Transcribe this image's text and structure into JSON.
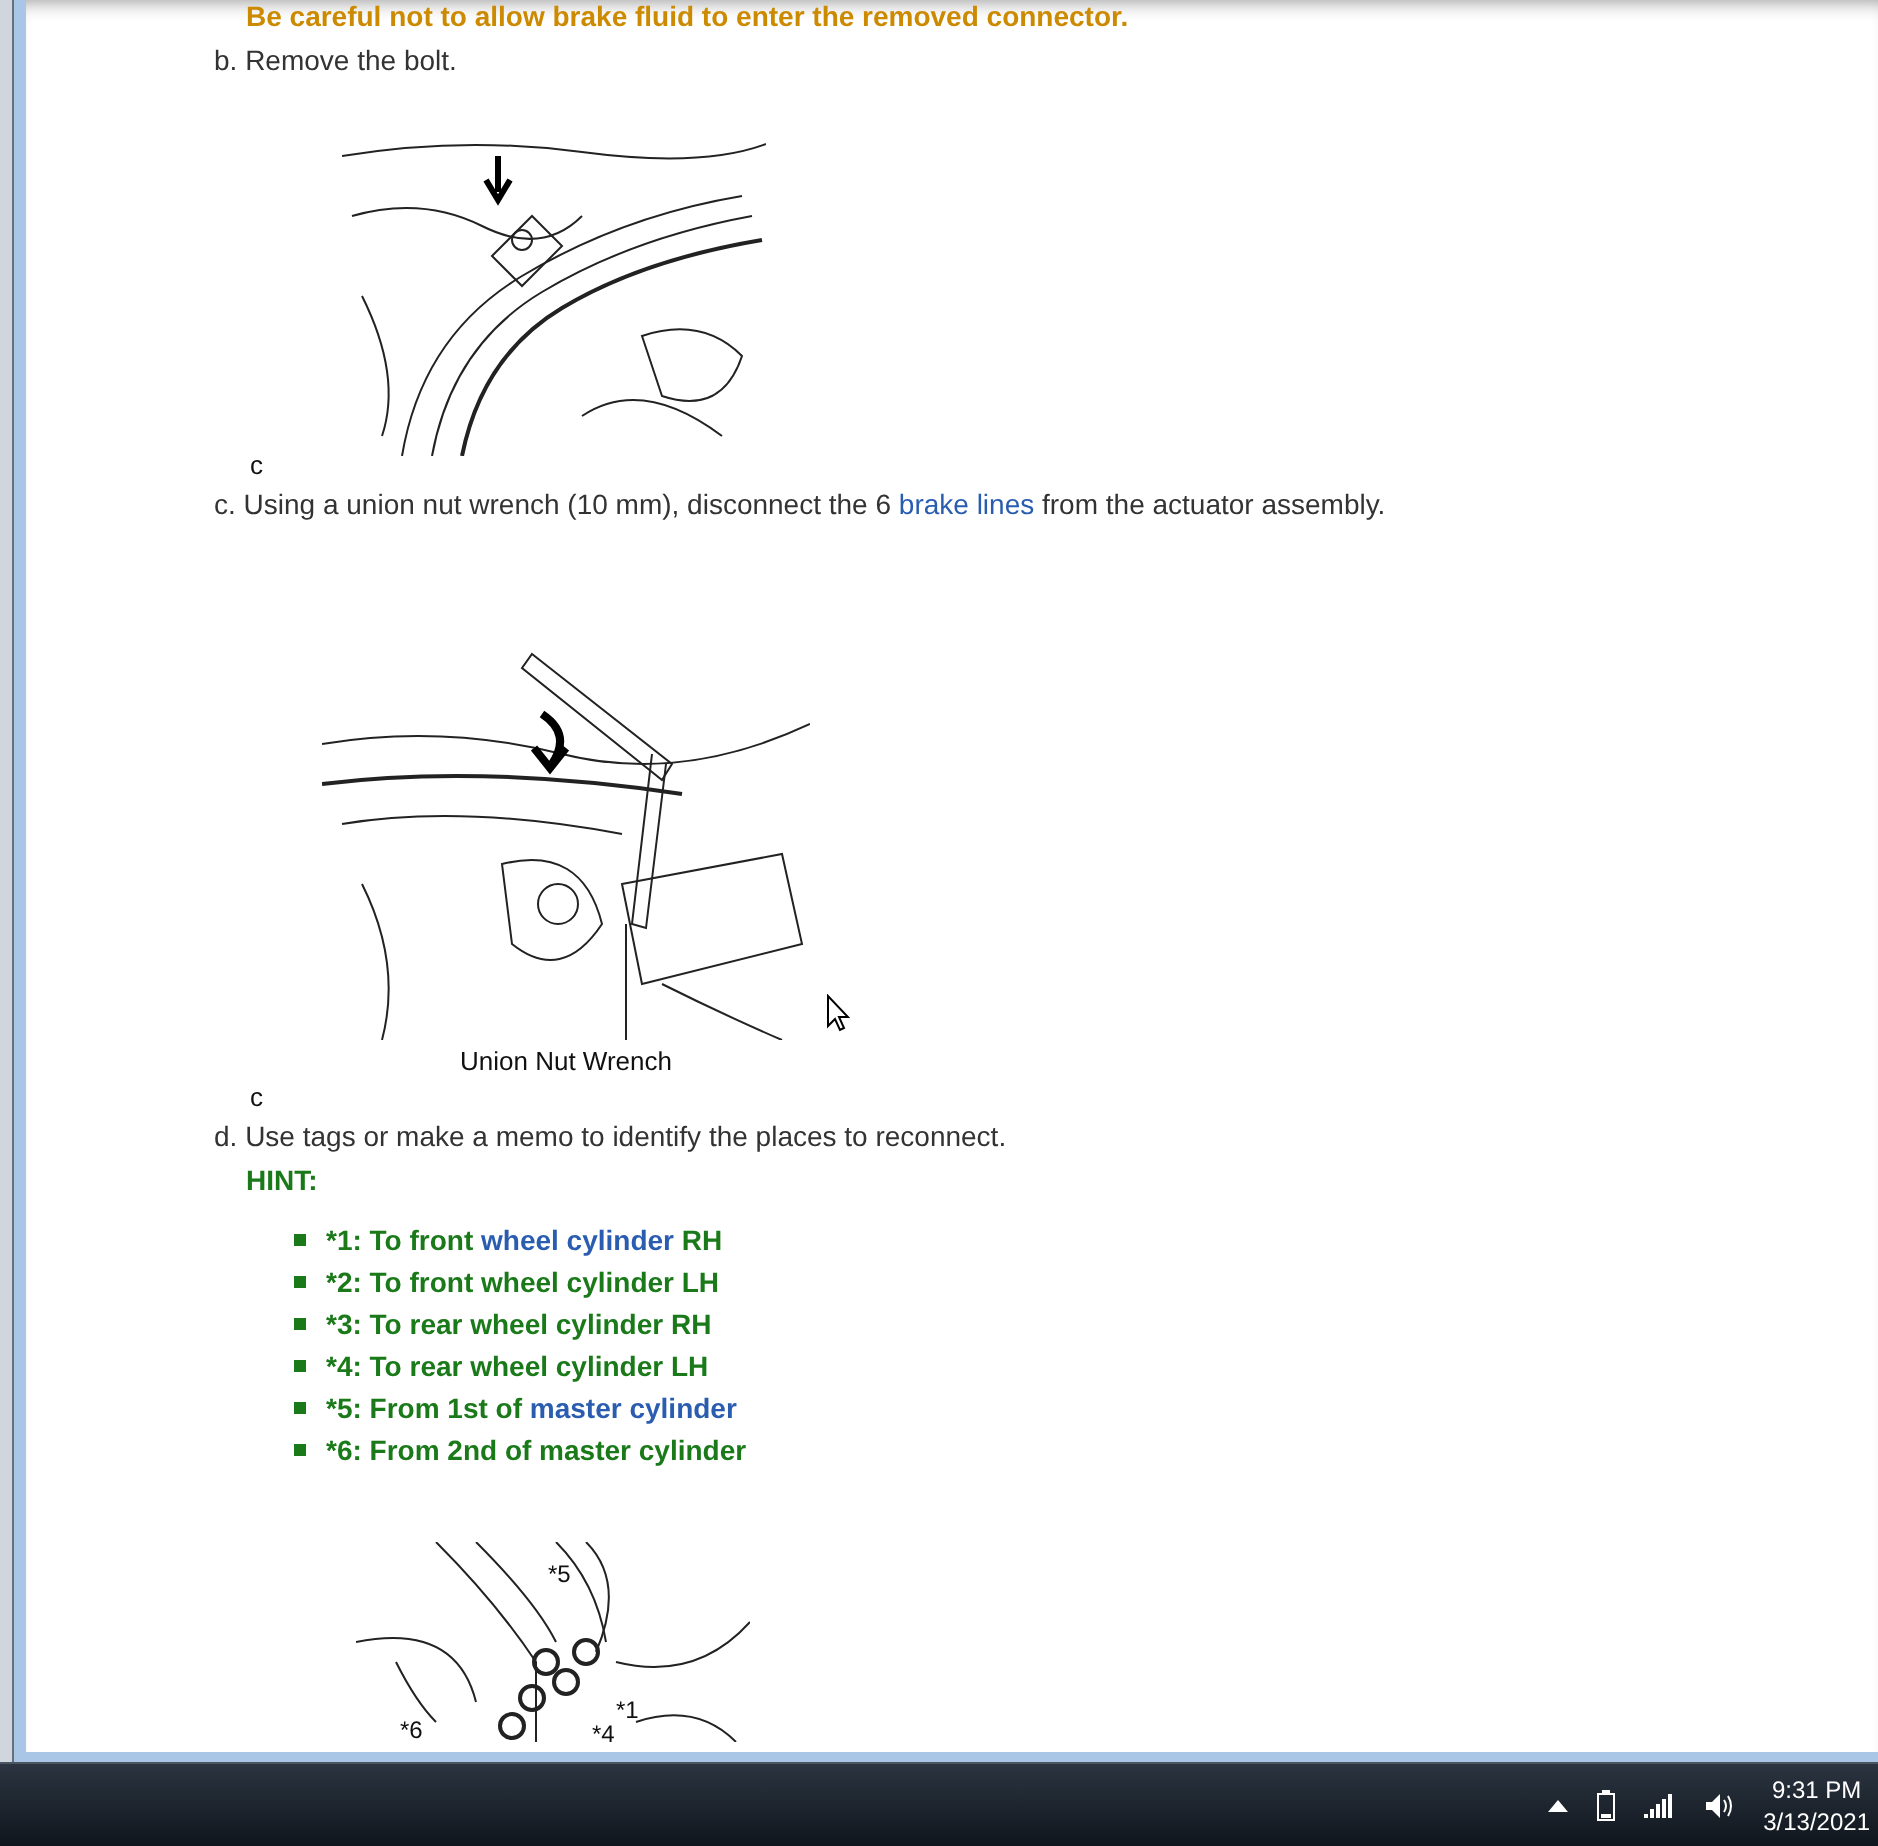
{
  "document": {
    "blocks": [
      {
        "kind": "caution",
        "segments": [
          {
            "text": "Be careful not to allow brake fluid to enter the removed connector.",
            "kind": "text"
          }
        ]
      },
      {
        "kind": "step",
        "segments": [
          {
            "text": "b. Remove the bolt.",
            "kind": "text"
          }
        ]
      },
      {
        "kind": "figure"
      },
      {
        "kind": "code",
        "text": "c"
      },
      {
        "kind": "step",
        "segments": [
          {
            "text": "c. Using a union nut wrench (10 mm), disconnect the 6 ",
            "kind": "text"
          },
          {
            "text": "brake lines",
            "kind": "link"
          },
          {
            "text": " from the actuator assembly.",
            "kind": "text"
          }
        ]
      },
      {
        "kind": "figure",
        "caption": "Union Nut Wrench"
      },
      {
        "kind": "code",
        "text": "c"
      },
      {
        "kind": "step",
        "segments": [
          {
            "text": "d. Use tags or make a memo to identify the places to reconnect.",
            "kind": "text"
          }
        ]
      },
      {
        "kind": "hint",
        "text": "HINT:"
      },
      {
        "kind": "list",
        "items": [
          [
            {
              "text": "*1: To front ",
              "kind": "text"
            },
            {
              "text": "wheel cylinder",
              "kind": "link"
            },
            {
              "text": " RH",
              "kind": "text"
            }
          ],
          [
            {
              "text": "*2: To front wheel cylinder LH",
              "kind": "text"
            }
          ],
          [
            {
              "text": "*3: To rear wheel cylinder RH",
              "kind": "text"
            }
          ],
          [
            {
              "text": "*4: To rear wheel cylinder LH",
              "kind": "text"
            }
          ],
          [
            {
              "text": "*5: From 1st of ",
              "kind": "text"
            },
            {
              "text": "master cylinder",
              "kind": "link"
            }
          ],
          [
            {
              "text": "*6: From 2nd of master cylinder",
              "kind": "text"
            }
          ]
        ]
      },
      {
        "kind": "figure",
        "callouts": [
          "*5",
          "*6",
          "*1",
          "*4"
        ]
      }
    ]
  },
  "taskbar": {
    "time": "9:31 PM",
    "date": "3/13/2021"
  }
}
